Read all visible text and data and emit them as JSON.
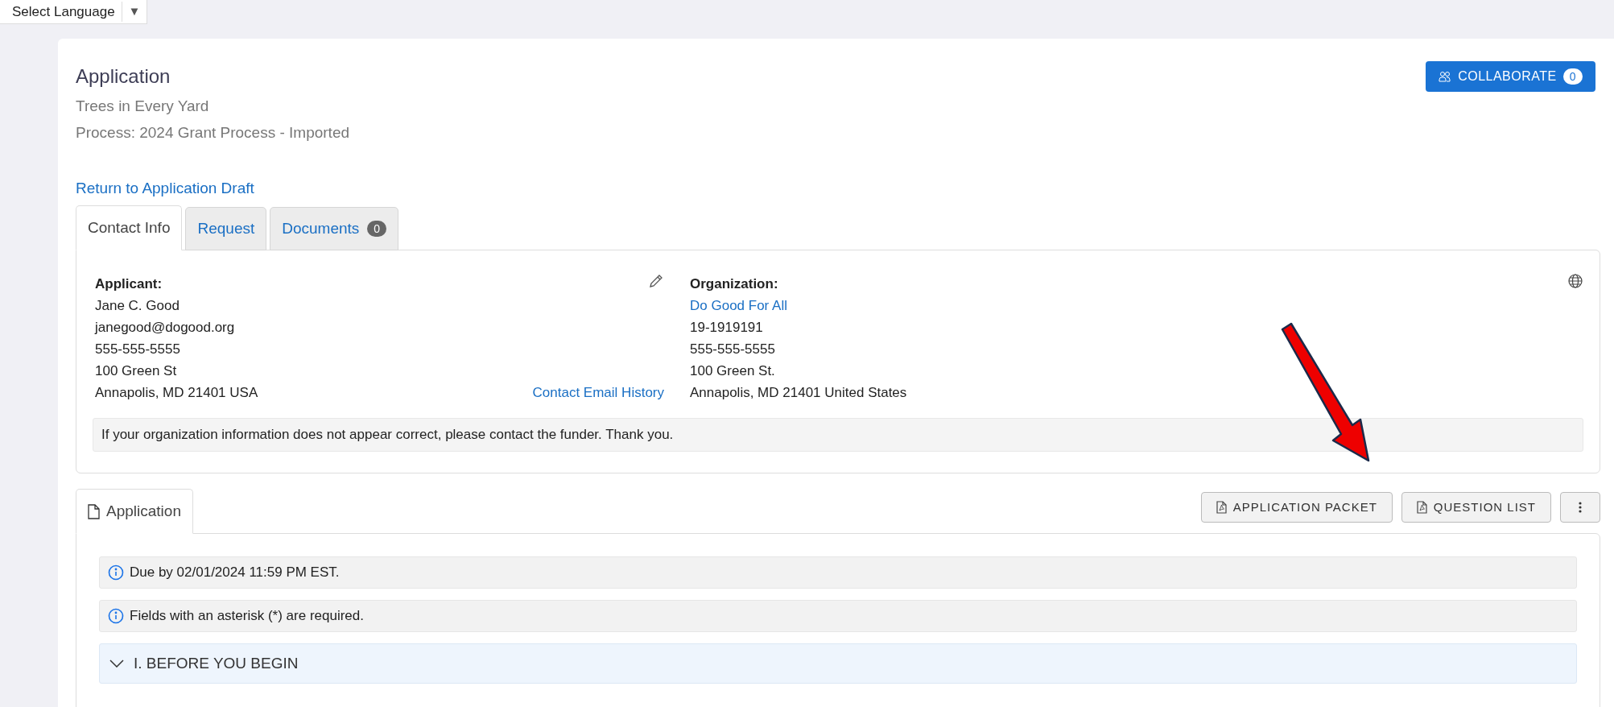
{
  "language_selector": {
    "label": "Select Language",
    "caret": "▼"
  },
  "header": {
    "title": "Application",
    "subtitle": "Trees in Every Yard",
    "process": "Process: 2024 Grant Process - Imported"
  },
  "collaborate_button": {
    "label": "COLLABORATE",
    "count": "0"
  },
  "return_link": "Return to Application Draft",
  "tabs": [
    {
      "label": "Contact Info",
      "selected": true
    },
    {
      "label": "Request",
      "selected": false
    },
    {
      "label": "Documents",
      "selected": false,
      "count": "0"
    }
  ],
  "applicant": {
    "heading": "Applicant:",
    "lines": [
      "Jane C. Good",
      "janegood@dogood.org",
      "555-555-5555",
      "100 Green St",
      "Annapolis, MD 21401 USA"
    ],
    "email_history_link": "Contact Email History"
  },
  "organization": {
    "heading": "Organization:",
    "name_link": "Do Good For All",
    "lines": [
      "19-1919191",
      "555-555-5555",
      "100 Green St.",
      "Annapolis, MD 21401 United States"
    ]
  },
  "notice": "If your organization information does not appear correct, please contact the funder. Thank you.",
  "application_tab": {
    "label": "Application",
    "selected": true
  },
  "actions": [
    {
      "label": "APPLICATION PACKET"
    },
    {
      "label": "QUESTION LIST"
    }
  ],
  "info_messages": [
    "Due by 02/01/2024 11:59 PM EST.",
    "Fields with an asterisk (*) are required."
  ],
  "sections": [
    {
      "title": "I. BEFORE YOU BEGIN",
      "expanded": true
    }
  ]
}
